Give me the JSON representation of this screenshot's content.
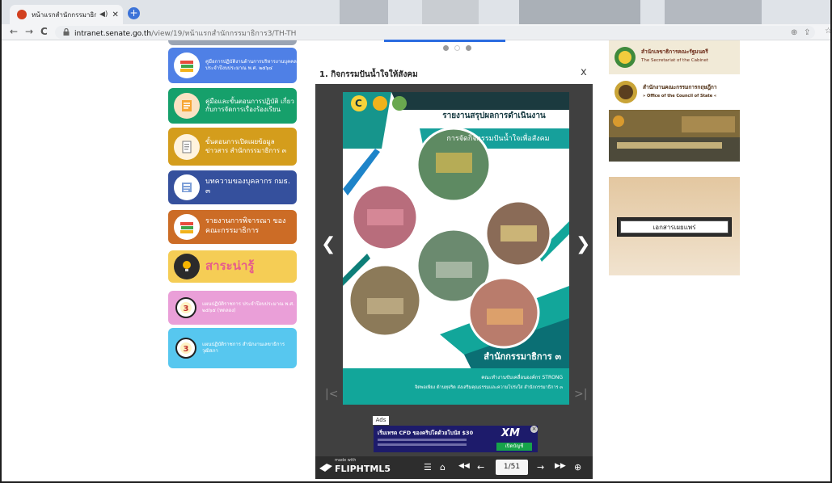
{
  "browser": {
    "tab_title": "หน้าแรกสำนักกรรมาธิการ3",
    "url_host": "intranet.senate.go.th",
    "url_path": "/view/19/หน้าแรกสำนักกรรมาธิการ3/TH-TH"
  },
  "sidebar": {
    "items": [
      {
        "label": "คู่มือการปฏิบัติงานด้านการบริหารงานบุคคล ประจำปีงบประมาณ พ.ศ. ๒๕๖๔",
        "color": "#4f80e6"
      },
      {
        "label": "คู่มือและขั้นตอนการปฏิบัติ เกี่ยวกับการจัดการเรื่องร้องเรียน",
        "color": "#16a06b"
      },
      {
        "label": "ขั้นตอนการเปิดเผยข้อมูลข่าวสาร สำนักกรรมาธิการ ๓",
        "color": "#d49d1c"
      },
      {
        "label": "บทความของบุคลากร กมธ. ๓",
        "color": "#35509d"
      },
      {
        "label": "รายงานการพิจารณา ของคณะกรรมาธิการ",
        "color": "#cc6c26"
      },
      {
        "label": "สาระน่ารู้",
        "color": "#f5cd55"
      },
      {
        "label": "แผนปฏิบัติราชการ ประจำปีงบประมาณ พ.ศ. ๒๕๖๕ (ทดลอง)",
        "color": "#ea9fd8"
      },
      {
        "label": "แผนปฏิบัติราชการ สำนักงานเลขาธิการวุฒิสภา",
        "color": "#57c7ef"
      }
    ]
  },
  "viewer": {
    "title": "1. กิจกรรมปันน้ำใจให้สังคม",
    "close": "x",
    "page": {
      "report_title": "รายงานสรุปผลการดำเนินงาน",
      "activity": "การจัดกิจกรรมปันน้ำใจเพื่อสังคม",
      "office": "สำนักกรรมาธิการ ๓",
      "footer_line1": "คณะทำงานขับเคลื่อนองค์กร STRONG",
      "footer_line2": "จิตพอเพียง ต้านทุจริต ส่งเสริมคุณธรรมและความโปร่งใส สำนักกรรมาธิการ ๓"
    },
    "ad": {
      "label": "Ads",
      "headline": "เริ่มเทรด CFD ของคริปโตด้วยโบนัส $30",
      "brand": "XM",
      "cta": "เปิดบัญชี"
    },
    "branding": {
      "made_with": "made with",
      "name": "FLIPHTML5"
    },
    "page_counter": "1/51"
  },
  "right_panel": {
    "cabinet_th": "สำนักเลขาธิการคณะรัฐมนตรี",
    "cabinet_en": "The Secretariat of the Cabinet",
    "council_th": "สำนักงานคณะกรรมการกฤษฎีกา",
    "council_en": "» Office of the Council of State «",
    "docs_label": "เอกสารเผยแพร่"
  }
}
